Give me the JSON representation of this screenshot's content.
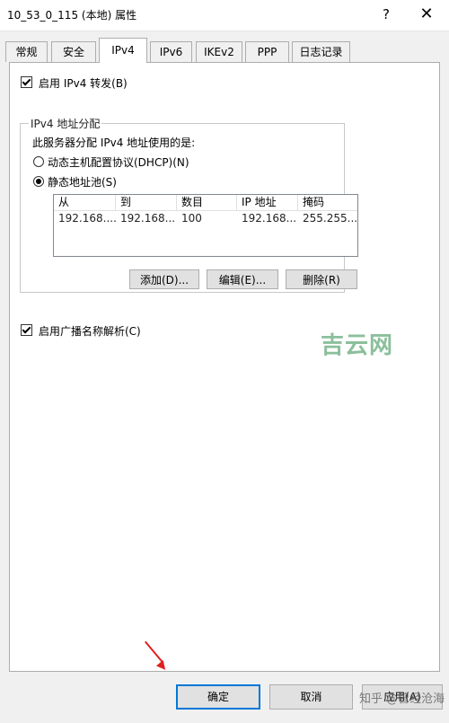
{
  "window": {
    "title": "10_53_0_115 (本地) 属性",
    "help_glyph": "?",
    "close_glyph": "✕"
  },
  "tabs": [
    {
      "label": "常规",
      "active": false
    },
    {
      "label": "安全",
      "active": false
    },
    {
      "label": "IPv4",
      "active": true
    },
    {
      "label": "IPv6",
      "active": false
    },
    {
      "label": "IKEv2",
      "active": false
    },
    {
      "label": "PPP",
      "active": false
    },
    {
      "label": "日志记录",
      "active": false
    }
  ],
  "ipv4": {
    "enable_forwarding": {
      "label": "启用 IPv4 转发(B)",
      "checked": true
    },
    "group": {
      "title": "IPv4 地址分配",
      "prompt": "此服务器分配 IPv4 地址使用的是:",
      "dhcp": {
        "label": "动态主机配置协议(DHCP)(N)",
        "selected": false
      },
      "static": {
        "label": "静态地址池(S)",
        "selected": true
      }
    },
    "table": {
      "columns": [
        "从",
        "到",
        "数目",
        "IP 地址",
        "掩码"
      ],
      "rows": [
        [
          "192.168....",
          "192.168...",
          "100",
          "192.168...",
          "255.255...."
        ]
      ]
    },
    "buttons": {
      "add": "添加(D)...",
      "edit": "编辑(E)...",
      "delete": "删除(R)"
    },
    "broadcast": {
      "label": "启用广播名称解析(C)",
      "checked": true
    }
  },
  "footer": {
    "ok": "确定",
    "cancel": "取消",
    "apply": "应用(A)"
  },
  "overlay": {
    "watermark_text": "吉云网",
    "attribution_text": "知乎 @曾经沧海",
    "arrow_color": "#e02020"
  },
  "colors": {
    "accent": "#0078d7"
  }
}
